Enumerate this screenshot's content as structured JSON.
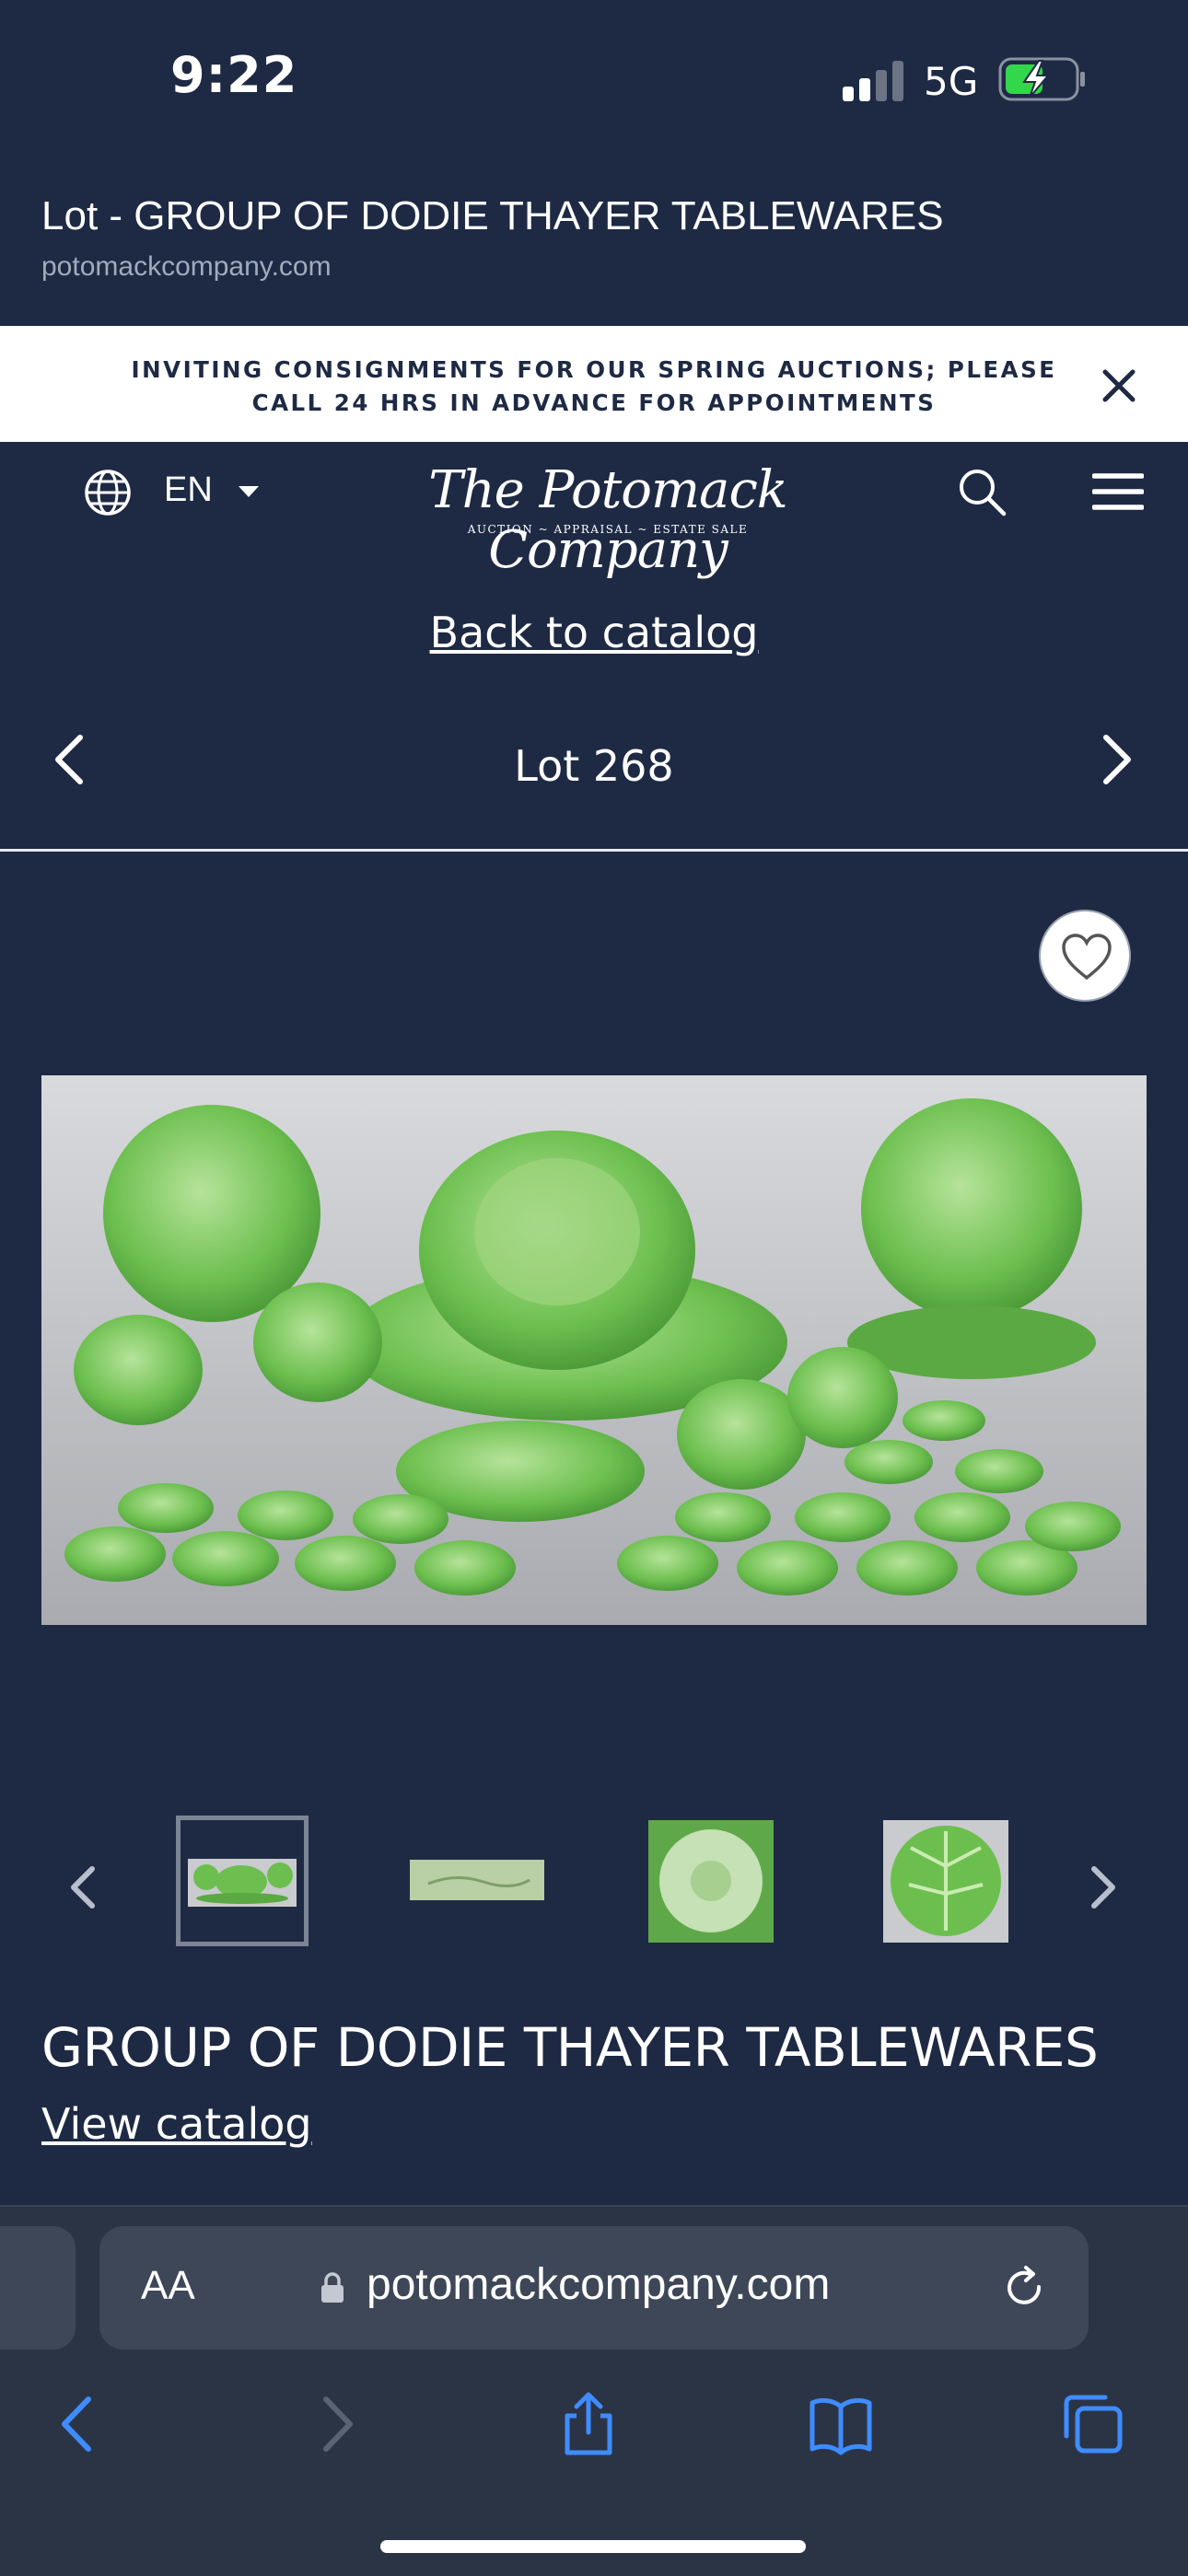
{
  "status_bar": {
    "time": "9:22",
    "network": "5G"
  },
  "page_header": {
    "title": "Lot - GROUP OF DODIE THAYER TABLEWARES",
    "domain": "potomackcompany.com"
  },
  "banner": {
    "text": "INVITING CONSIGNMENTS FOR OUR SPRING AUCTIONS; PLEASE CALL 24 HRS IN ADVANCE FOR APPOINTMENTS"
  },
  "site_nav": {
    "language": "EN",
    "logo_main": "The Potomack Company",
    "logo_sub": "AUCTION ~ APPRAISAL ~ ESTATE SALE"
  },
  "lot_nav": {
    "back_link": "Back to catalog",
    "lot_label": "Lot 268"
  },
  "lot": {
    "title": "GROUP OF DODIE THAYER TABLEWARES",
    "view_catalog": "View catalog"
  },
  "browser": {
    "aa_label": "AA",
    "url": "potomackcompany.com"
  },
  "colors": {
    "background": "#1e2a44",
    "banner_bg": "#ffffff",
    "accent_link": "#3f8cff"
  }
}
